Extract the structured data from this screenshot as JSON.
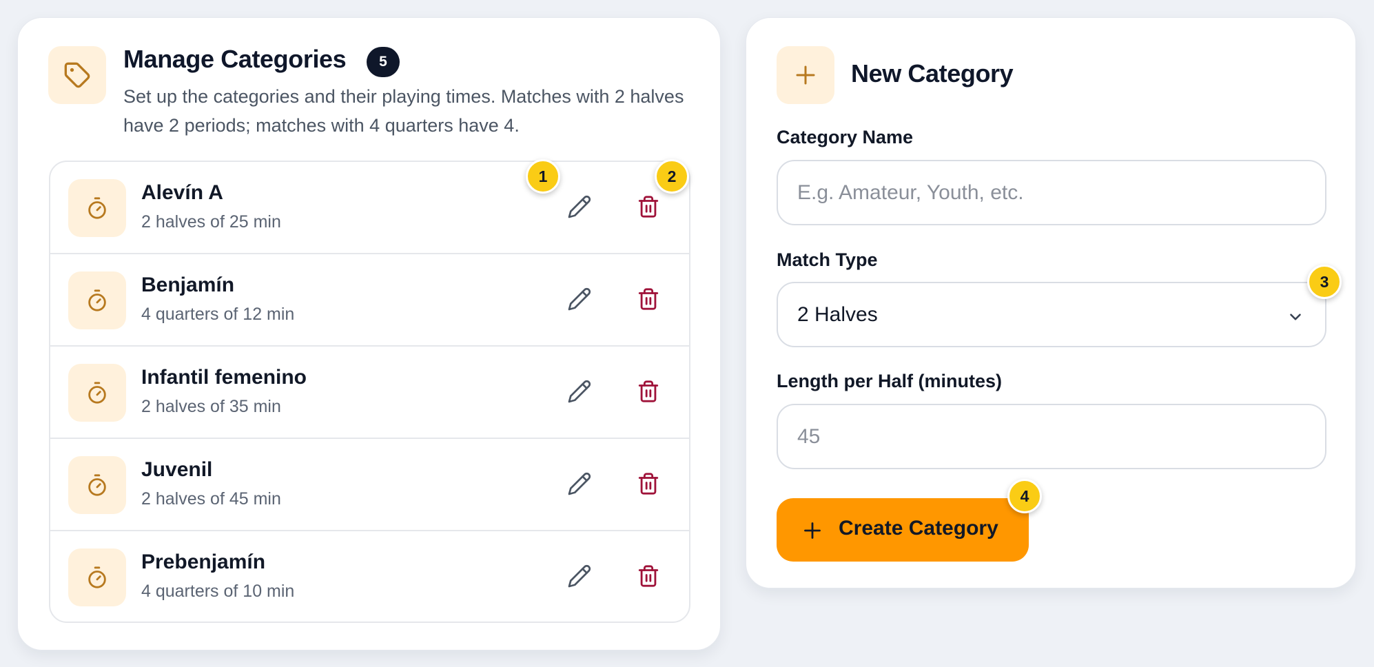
{
  "manage": {
    "title": "Manage Categories",
    "count": "5",
    "description": "Set up the categories and their playing times. Matches with 2 halves have 2 periods; matches with 4 quarters have 4.",
    "categories": [
      {
        "name": "Alevín A",
        "detail": "2 halves of 25 min"
      },
      {
        "name": "Benjamín",
        "detail": "4 quarters of 12 min"
      },
      {
        "name": "Infantil femenino",
        "detail": "2 halves of 35 min"
      },
      {
        "name": "Juvenil",
        "detail": "2 halves of 45 min"
      },
      {
        "name": "Prebenjamín",
        "detail": "4 quarters of 10 min"
      }
    ]
  },
  "new_category": {
    "title": "New Category",
    "name_label": "Category Name",
    "name_placeholder": "E.g. Amateur, Youth, etc.",
    "match_type_label": "Match Type",
    "match_type_value": "2 Halves",
    "length_label": "Length per Half (minutes)",
    "length_placeholder": "45",
    "create_label": "Create Category"
  },
  "markers": [
    "1",
    "2",
    "3",
    "4"
  ],
  "colors": {
    "accent": "#ff9700",
    "icon_tile": "#fff1dc",
    "icon_stroke": "#b7791f",
    "delete": "#9f1239",
    "edit": "#4b5563",
    "marker": "#facc15",
    "badge": "#0f172a"
  },
  "icons": {
    "header": "tag-icon",
    "row": "stopwatch-icon",
    "edit": "pencil-icon",
    "delete": "trash-icon",
    "new": "plus-icon",
    "select": "chevron-down-icon"
  }
}
